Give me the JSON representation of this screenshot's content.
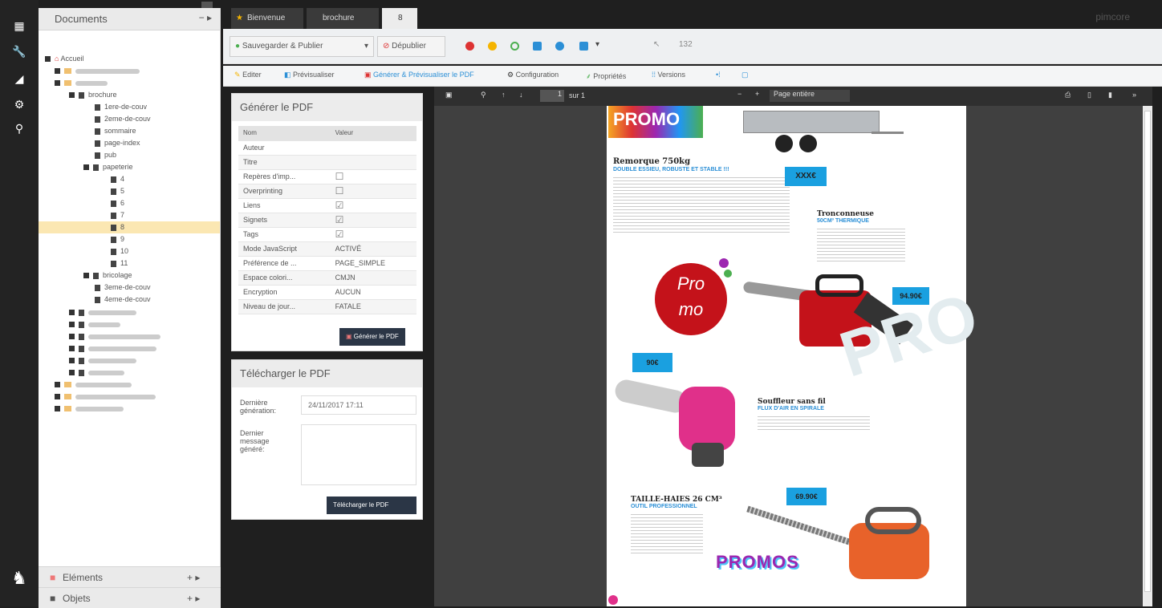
{
  "sidebar": {
    "icons": [
      "grid-icon",
      "wrench-icon",
      "chart-icon",
      "gear-icon",
      "search-icon"
    ]
  },
  "tree": {
    "title": "Documents",
    "actions": "−  ▸",
    "root": "Accueil",
    "brochure": "brochure",
    "items": [
      "1ere-de-couv",
      "2eme-de-couv",
      "sommaire",
      "page-index",
      "pub"
    ],
    "papeterie": "papeterie",
    "numbers": [
      "4",
      "5",
      "6",
      "7",
      "8",
      "9",
      "10",
      "11"
    ],
    "bricolage": "bricolage",
    "bricoItems": [
      "3eme-de-couv",
      "4eme-de-couv"
    ]
  },
  "bottom": {
    "elements": "Eléments",
    "objets": "Objets",
    "actions": "+ ▸"
  },
  "tabs": {
    "bienvenue": "Bienvenue",
    "brochure": "brochure",
    "eight": "8",
    "brand": "pimcore"
  },
  "toolbar": {
    "save": "Sauvegarder & Publier",
    "unpublish": "Dépublier",
    "id": "132"
  },
  "subtabs": {
    "edit": "Editer",
    "preview": "Prévisualiser",
    "generate": "Générer & Prévisualiser le PDF",
    "config": "Configuration",
    "props": "Propriétés",
    "versions": "Versions"
  },
  "genpdf": {
    "title": "Générer le PDF",
    "colName": "Nom",
    "colValue": "Valeur",
    "rows": [
      {
        "k": "Auteur",
        "v": ""
      },
      {
        "k": "Titre",
        "v": ""
      },
      {
        "k": "Repères d'imp...",
        "v": "☐"
      },
      {
        "k": "Overprinting",
        "v": "☐"
      },
      {
        "k": "Liens",
        "v": "☑"
      },
      {
        "k": "Signets",
        "v": "☑"
      },
      {
        "k": "Tags",
        "v": "☑"
      },
      {
        "k": "Mode JavaScript",
        "v": "ACTIVÉ"
      },
      {
        "k": "Préférence de ...",
        "v": "PAGE_SIMPLE"
      },
      {
        "k": "Espace colori...",
        "v": "CMJN"
      },
      {
        "k": "Encryption",
        "v": "AUCUN"
      },
      {
        "k": "Niveau de jour...",
        "v": "FATALE"
      }
    ],
    "button": "Générer le PDF"
  },
  "download": {
    "title": "Télécharger le PDF",
    "lastGenLabel": "Dernière génération:",
    "lastGenValue": "24/11/2017 17:11",
    "lastMsgLabel": "Dernier message généré:",
    "button": "Télécharger le PDF"
  },
  "viewer": {
    "pageNum": "1",
    "pageOf": "sur 1",
    "zoom": "Page entière"
  },
  "pdf": {
    "promo": "PROMO",
    "remorque": "Remorque 750kg",
    "remorqueSub": "DOUBLE ESSIEU, ROBUSTE ET STABLE !!!",
    "priceX": "XXX€",
    "tronconneuse": "Tronconneuse",
    "tronSub": "50CM³ THERMIQUE",
    "price1": "94.90€",
    "price2": "90€",
    "souffleur": "Souffleur sans fil",
    "soufSub": "FLUX D'AIR EN SPIRALE",
    "taille": "TAILLE-HAIES 26 CM³",
    "tailleSub": "OUTIL PROFESSIONNEL",
    "price3": "69.90€",
    "promos": "PROMOS",
    "promo2a": "Pro",
    "promo2b": "mo"
  }
}
